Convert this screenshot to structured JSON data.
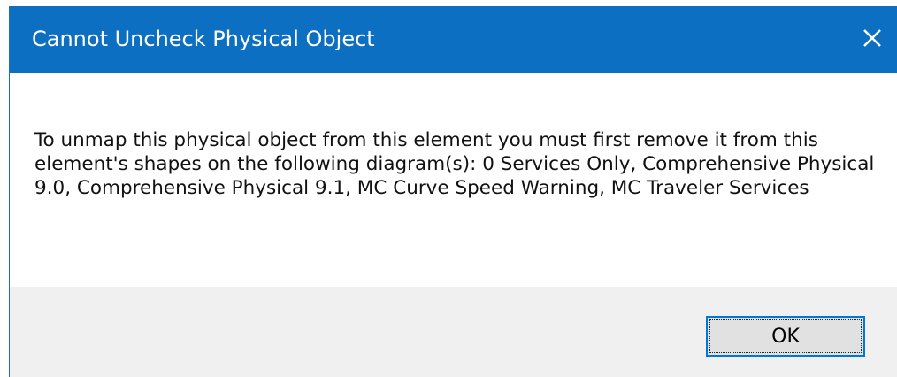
{
  "dialog": {
    "title": "Cannot Uncheck Physical Object",
    "message": "To unmap this physical object from this element you must first remove it from this element's shapes on the following diagram(s): 0 Services Only, Comprehensive Physical 9.0, Comprehensive Physical 9.1, MC Curve Speed Warning, MC Traveler Services",
    "ok_label": "OK"
  },
  "icons": {
    "close": "close-icon"
  },
  "colors": {
    "titlebar": "#0d6fc1",
    "footer": "#f0f0f0",
    "button_border": "#0078d7"
  }
}
